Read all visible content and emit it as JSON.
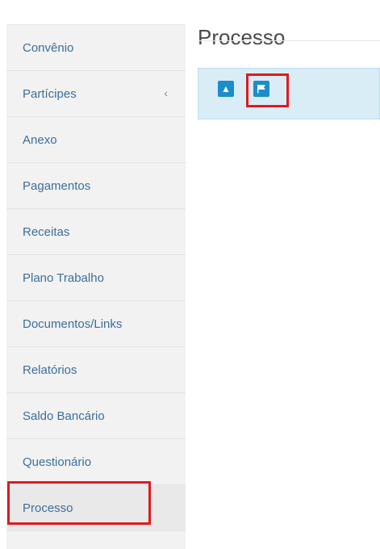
{
  "page": {
    "title": "Processo"
  },
  "sidebar": {
    "items": [
      {
        "label": "Convênio"
      },
      {
        "label": "Partícipes",
        "chevron": "‹"
      },
      {
        "label": "Anexo"
      },
      {
        "label": "Pagamentos"
      },
      {
        "label": "Receitas"
      },
      {
        "label": "Plano Trabalho"
      },
      {
        "label": "Documentos/Links"
      },
      {
        "label": "Relatórios"
      },
      {
        "label": "Saldo Bancário"
      },
      {
        "label": "Questionário"
      },
      {
        "label": "Processo",
        "active": true
      }
    ]
  },
  "toolbar": {
    "alert_icon": "▲",
    "buttons": [
      "alert-triangle-icon",
      "flag-icon"
    ]
  },
  "colors": {
    "accent": "#1d8dc9",
    "highlight": "#e0191e",
    "panel_bg": "#d9edf7",
    "link": "#3c6e9b"
  }
}
